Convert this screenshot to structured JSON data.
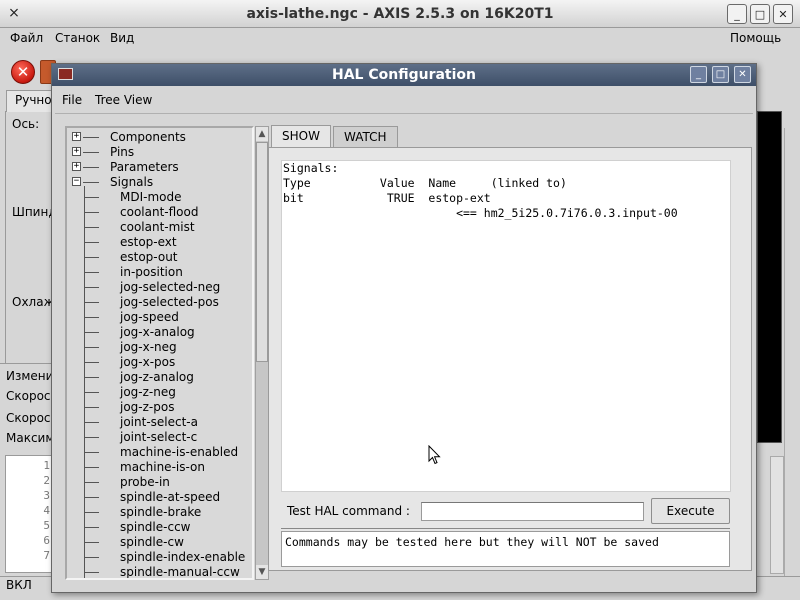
{
  "main_window": {
    "title": "axis-lathe.ngc - AXIS 2.5.3 on 16K20T1",
    "menu": {
      "file": "Файл",
      "machine": "Станок",
      "view": "Вид",
      "help": "Помощь"
    },
    "left_tab": "Ручно",
    "left_labels": {
      "axis": "Ось:",
      "spindle": "Шпинд",
      "coolant": "Охлаж"
    },
    "left_fields": [
      "Измени",
      "Скорос",
      "Скорос",
      "Максим"
    ],
    "gcode_line_numbers": [
      "1",
      "2",
      "3",
      "4",
      "5",
      "6",
      "7"
    ],
    "status": "ВКЛ"
  },
  "hal_window": {
    "title": "HAL Configuration",
    "menu": {
      "file": "File",
      "tree_view": "Tree View"
    },
    "tree": {
      "top": [
        {
          "label": "Components",
          "expanded": false
        },
        {
          "label": "Pins",
          "expanded": false
        },
        {
          "label": "Parameters",
          "expanded": false
        },
        {
          "label": "Signals",
          "expanded": true
        }
      ],
      "signals": [
        "MDI-mode",
        "coolant-flood",
        "coolant-mist",
        "estop-ext",
        "estop-out",
        "in-position",
        "jog-selected-neg",
        "jog-selected-pos",
        "jog-speed",
        "jog-x-analog",
        "jog-x-neg",
        "jog-x-pos",
        "jog-z-analog",
        "jog-z-neg",
        "jog-z-pos",
        "joint-select-a",
        "joint-select-c",
        "machine-is-enabled",
        "machine-is-on",
        "probe-in",
        "spindle-at-speed",
        "spindle-brake",
        "spindle-ccw",
        "spindle-cw",
        "spindle-index-enable",
        "spindle-manual-ccw"
      ]
    },
    "tabs": {
      "show": "SHOW",
      "watch": "WATCH"
    },
    "show_lines": [
      "Signals:",
      "Type          Value  Name     (linked to)",
      "bit            TRUE  estop-ext",
      "                         <== hm2_5i25.0.7i76.0.3.input-00"
    ],
    "command": {
      "label": "Test HAL command :",
      "value": "",
      "execute": "Execute",
      "result": "Commands may be tested here but they will NOT be saved"
    }
  },
  "colors": {
    "hal_titlebar": "#4e5f78",
    "estop": "#c91a10",
    "text_bg": "#ffffff"
  }
}
